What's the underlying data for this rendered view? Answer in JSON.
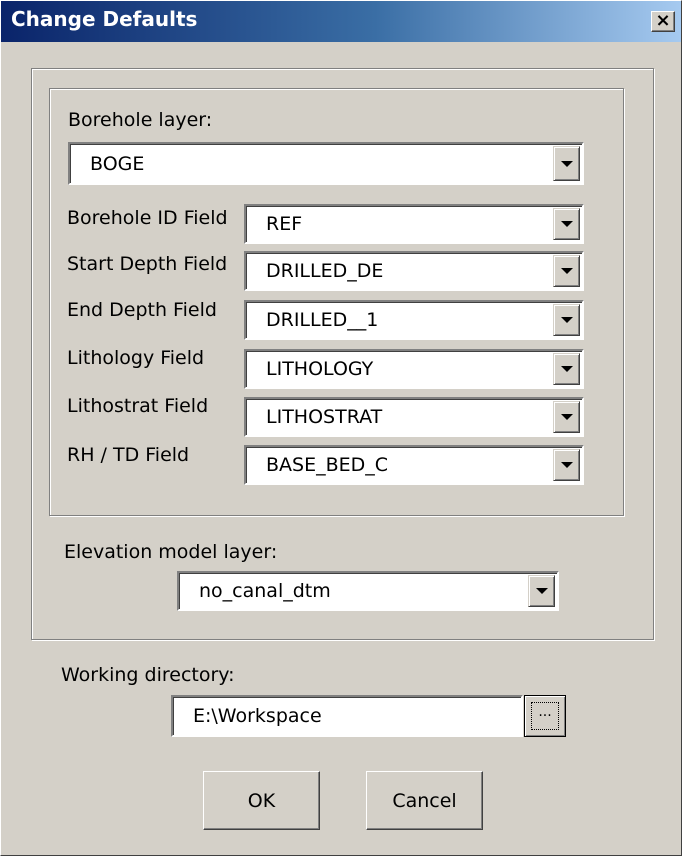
{
  "window": {
    "title": "Change Defaults",
    "close_glyph": "×"
  },
  "borehole": {
    "layer_label": "Borehole layer:",
    "layer_value": "BOGE",
    "fields": [
      {
        "label": "Borehole ID Field",
        "value": "REF"
      },
      {
        "label": "Start Depth Field",
        "value": "DRILLED_DE"
      },
      {
        "label": "End Depth Field",
        "value": "DRILLED__1"
      },
      {
        "label": "Lithology Field",
        "value": "LITHOLOGY"
      },
      {
        "label": "Lithostrat Field",
        "value": "LITHOSTRAT"
      },
      {
        "label": "RH / TD Field",
        "value": "BASE_BED_C"
      }
    ]
  },
  "elevation": {
    "label": "Elevation model layer:",
    "value": "no_canal_dtm"
  },
  "working_dir": {
    "label": "Working directory:",
    "value": "E:\\Workspace",
    "browse_label": "..."
  },
  "buttons": {
    "ok": "OK",
    "cancel": "Cancel"
  },
  "icons": {
    "close": "close-icon",
    "dropdown": "chevron-down-icon",
    "browse": "ellipsis-icon"
  }
}
